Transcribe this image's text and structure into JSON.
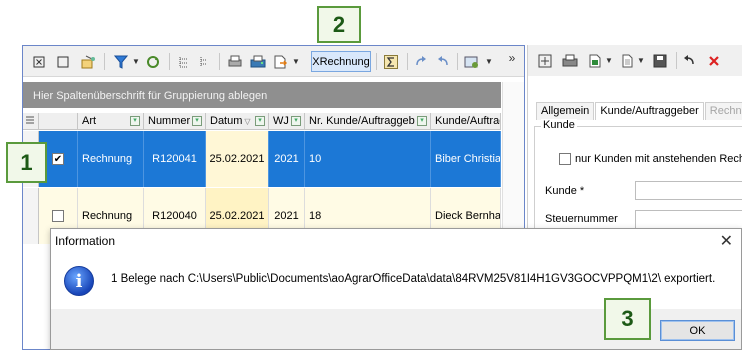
{
  "toolbar": {
    "xrechnung_label": "XRechnung",
    "overflow_label": "»"
  },
  "grid": {
    "group_placeholder": "Hier Spaltenüberschrift für Gruppierung ablegen",
    "columns": [
      "Art",
      "Nummer",
      "Datum",
      "WJ",
      "Nr. Kunde/Auftraggeb",
      "Kunde/Auftrag"
    ],
    "rows": [
      {
        "checked": "✔",
        "art": "Rechnung",
        "nummer": "R120041",
        "datum": "25.02.2021",
        "wj": "2021",
        "nr_kunde": "10",
        "kunde": "Biber Christian"
      },
      {
        "checked": "",
        "art": "Rechnung",
        "nummer": "R120040",
        "datum": "25.02.2021",
        "wj": "2021",
        "nr_kunde": "18",
        "kunde": "Dieck Bernhar"
      }
    ]
  },
  "right_panel": {
    "tabs": [
      "Allgemein",
      "Kunde/Auftraggeber",
      "Rechnu"
    ],
    "group_title": "Kunde",
    "checkbox_label": "nur Kunden mit anstehenden Rechn",
    "kunde_label": "Kunde *",
    "steuernummer_label": "Steuernummer"
  },
  "dialog": {
    "title": "Information",
    "message": "1 Belege nach C:\\Users\\Public\\Documents\\aoAgrarOfficeData\\data\\84RVM25V81I4H1GV3GOCVPPQM1\\2\\ exportiert.",
    "ok_label": "OK",
    "close_glyph": "✕",
    "info_glyph": "i"
  },
  "callouts": {
    "one": "1",
    "two": "2",
    "three": "3"
  },
  "colors": {
    "selection": "#1c78d6",
    "callout_border": "#5a9a3c",
    "group_bar": "#8f8f8f"
  }
}
